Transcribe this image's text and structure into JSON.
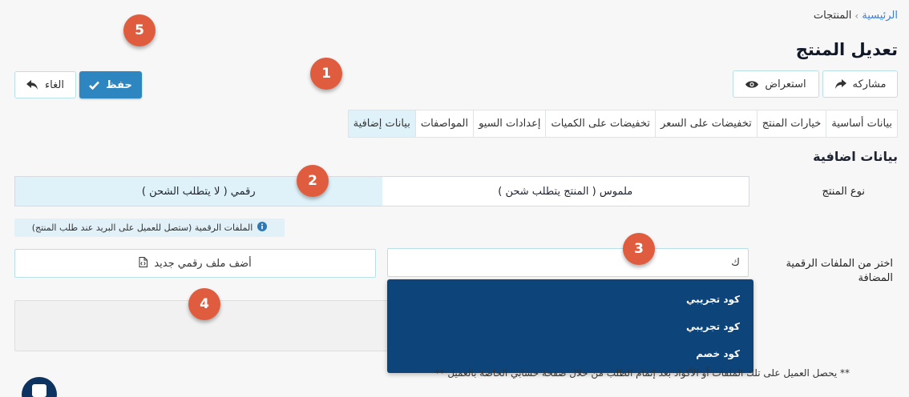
{
  "breadcrumb": {
    "home": "الرئيسية",
    "separator": "›",
    "current": "المنتجات"
  },
  "page_title": "تعديل المنتج",
  "toolbar": {
    "save_label": "حفظ",
    "cancel_label": "الغاء",
    "preview_label": "استعراض",
    "share_label": "مشاركه"
  },
  "tabs": [
    {
      "label": "بيانات أساسية",
      "active": false
    },
    {
      "label": "خيارات المنتج",
      "active": false
    },
    {
      "label": "تخفيضات على السعر",
      "active": false
    },
    {
      "label": "تخفيضات على الكميات",
      "active": false
    },
    {
      "label": "إعدادات السيو",
      "active": false
    },
    {
      "label": "المواصفات",
      "active": false
    },
    {
      "label": "بيانات إضافية",
      "active": true
    }
  ],
  "section_title": "بيانات اضافية",
  "product_type": {
    "label": "نوع المنتج",
    "options": [
      {
        "label": "ملموس ( المنتج يتطلب شحن )",
        "selected": false
      },
      {
        "label": "رقمي ( لا يتطلب الشحن )",
        "selected": true
      }
    ]
  },
  "digital_notice": "الملفات الرقمية (ستصل للعميل على البريد عند طلب المنتج)",
  "digital_files": {
    "label": "اختر من الملفات الرقمية المضافة",
    "search_value": "ك",
    "add_button_label": "أضف ملف رقمي جديد",
    "dropdown_options": [
      "كود تجريبي",
      "كود تجريبي",
      "كود خصم"
    ]
  },
  "footnote": "** يحصل العميل على تلك الملفات أو الأكواد بعد إتمام الطلب من خلال صفحة حسابي الخاصة بالعميل **",
  "markers": [
    "1",
    "2",
    "3",
    "4",
    "5"
  ],
  "colors": {
    "accent": "#2e86c1",
    "marker": "#df5d3e",
    "dropdown_bg": "#0d4479",
    "selected_bg": "#dff2fa",
    "link": "#3f7dd6"
  }
}
